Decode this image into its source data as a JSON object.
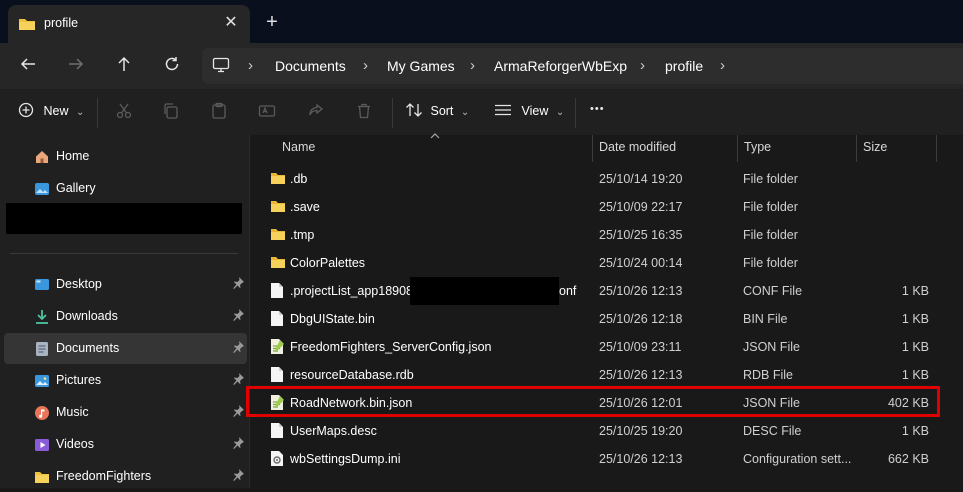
{
  "tab": {
    "title": "profile",
    "close_glyph": "✕",
    "new_tab_glyph": "+"
  },
  "nav": {
    "back_icon": "arrow-left-icon",
    "forward_icon": "arrow-right-icon",
    "up_icon": "arrow-up-icon",
    "refresh_icon": "refresh-icon",
    "breadcrumbs": [
      "Documents",
      "My Games",
      "ArmaReforgerWbExp",
      "profile"
    ],
    "separator": "›"
  },
  "toolbar": {
    "new_label": "New",
    "sort_label": "Sort",
    "view_label": "View",
    "more_label": "•••",
    "dropdown_glyph": "⌄"
  },
  "sidebar": {
    "top_items": [
      {
        "label": "Home",
        "icon": "home-icon"
      },
      {
        "label": "Gallery",
        "icon": "gallery-icon"
      }
    ],
    "quick_access": [
      {
        "label": "Desktop",
        "icon": "desktop-icon",
        "color": "#3a96dd"
      },
      {
        "label": "Downloads",
        "icon": "download-icon",
        "color": "#4cc2a0"
      },
      {
        "label": "Documents",
        "icon": "documents-icon",
        "color": "#a9b4c2",
        "selected": true
      },
      {
        "label": "Pictures",
        "icon": "pictures-icon",
        "color": "#3a96dd"
      },
      {
        "label": "Music",
        "icon": "music-icon",
        "color": "#e8745a"
      },
      {
        "label": "Videos",
        "icon": "videos-icon",
        "color": "#8a5bd6"
      },
      {
        "label": "FreedomFighters",
        "icon": "folder-icon",
        "color": "#f0c23b"
      }
    ],
    "pin_glyph": "📌"
  },
  "columns": {
    "name": "Name",
    "date": "Date modified",
    "type": "Type",
    "size": "Size"
  },
  "files": [
    {
      "name": ".db",
      "date": "25/10/14 19:20",
      "type": "File folder",
      "size": "",
      "icon": "folder-icon"
    },
    {
      "name": ".save",
      "date": "25/10/09 22:17",
      "type": "File folder",
      "size": "",
      "icon": "folder-icon"
    },
    {
      "name": ".tmp",
      "date": "25/10/25 16:35",
      "type": "File folder",
      "size": "",
      "icon": "folder-icon"
    },
    {
      "name": "ColorPalettes",
      "date": "25/10/24 00:14",
      "type": "File folder",
      "size": "",
      "icon": "folder-icon"
    },
    {
      "name": ".projectList_app189088",
      "name_suffix": "onf",
      "date": "25/10/26 12:13",
      "type": "CONF File",
      "size": "1 KB",
      "icon": "file-icon",
      "redacted": true
    },
    {
      "name": "DbgUIState.bin",
      "date": "25/10/26 12:18",
      "type": "BIN File",
      "size": "1 KB",
      "icon": "file-icon"
    },
    {
      "name": "FreedomFighters_ServerConfig.json",
      "date": "25/10/09 23:11",
      "type": "JSON File",
      "size": "1 KB",
      "icon": "json-file-icon"
    },
    {
      "name": "resourceDatabase.rdb",
      "date": "25/10/26 12:13",
      "type": "RDB File",
      "size": "1 KB",
      "icon": "file-icon"
    },
    {
      "name": "RoadNetwork.bin.json",
      "date": "25/10/26 12:01",
      "type": "JSON File",
      "size": "402 KB",
      "icon": "json-file-icon",
      "highlighted": true
    },
    {
      "name": "UserMaps.desc",
      "date": "25/10/25 19:20",
      "type": "DESC File",
      "size": "1 KB",
      "icon": "file-icon"
    },
    {
      "name": "wbSettingsDump.ini",
      "date": "25/10/26 12:13",
      "type": "Configuration sett...",
      "size": "662 KB",
      "icon": "ini-file-icon"
    }
  ],
  "colors": {
    "highlight": "#e00000",
    "folder": "#f0c23b",
    "accent": "#3a96dd"
  }
}
